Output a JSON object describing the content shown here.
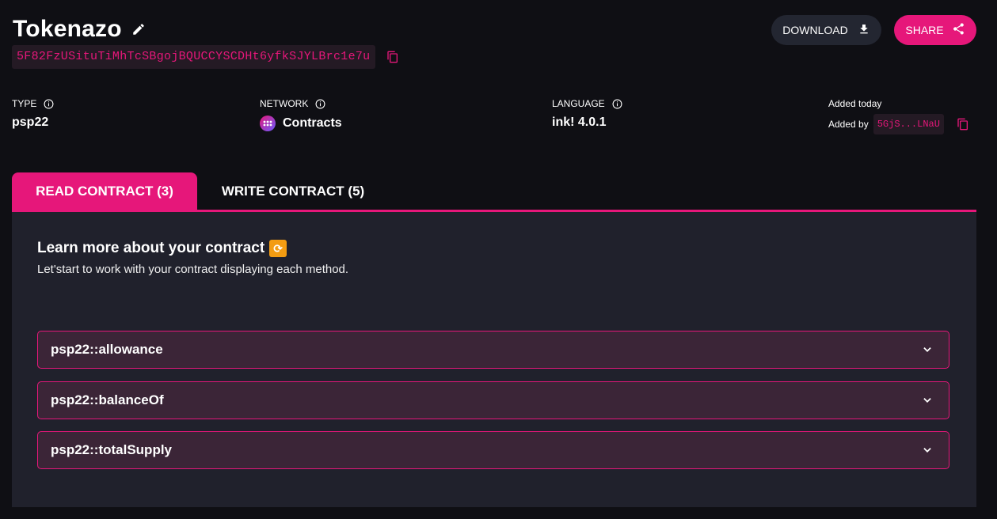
{
  "contract": {
    "name": "Tokenazo",
    "address": "5F82FzUSituTiMhTcSBgojBQUCCYSCDHt6yfkSJYLBrc1e7u"
  },
  "actions": {
    "download": "DOWNLOAD",
    "share": "SHARE"
  },
  "meta": {
    "type_label": "TYPE",
    "type_value": "psp22",
    "network_label": "NETWORK",
    "network_value": "Contracts",
    "language_label": "LANGUAGE",
    "language_value": "ink! 4.0.1",
    "added_today": "Added today",
    "added_by_label": "Added by",
    "added_by_address": "5GjS...LNaU"
  },
  "tabs": [
    {
      "label": "READ CONTRACT (3)",
      "active": true
    },
    {
      "label": "WRITE CONTRACT (5)",
      "active": false
    }
  ],
  "panel": {
    "heading": "Learn more about your contract",
    "subtitle": "Let'start to work with your contract displaying each method."
  },
  "methods": [
    {
      "label": "psp22::allowance"
    },
    {
      "label": "psp22::balanceOf"
    },
    {
      "label": "psp22::totalSupply"
    }
  ],
  "colors": {
    "accent": "#e6177a",
    "background": "#0f0f14",
    "panel": "#20212c",
    "accordion": "#3b2537"
  },
  "icons": [
    "pencil-icon",
    "copy-icon",
    "download-icon",
    "share-icon",
    "info-icon",
    "network-icon",
    "repeat-emoji-icon",
    "chevron-down-icon"
  ]
}
